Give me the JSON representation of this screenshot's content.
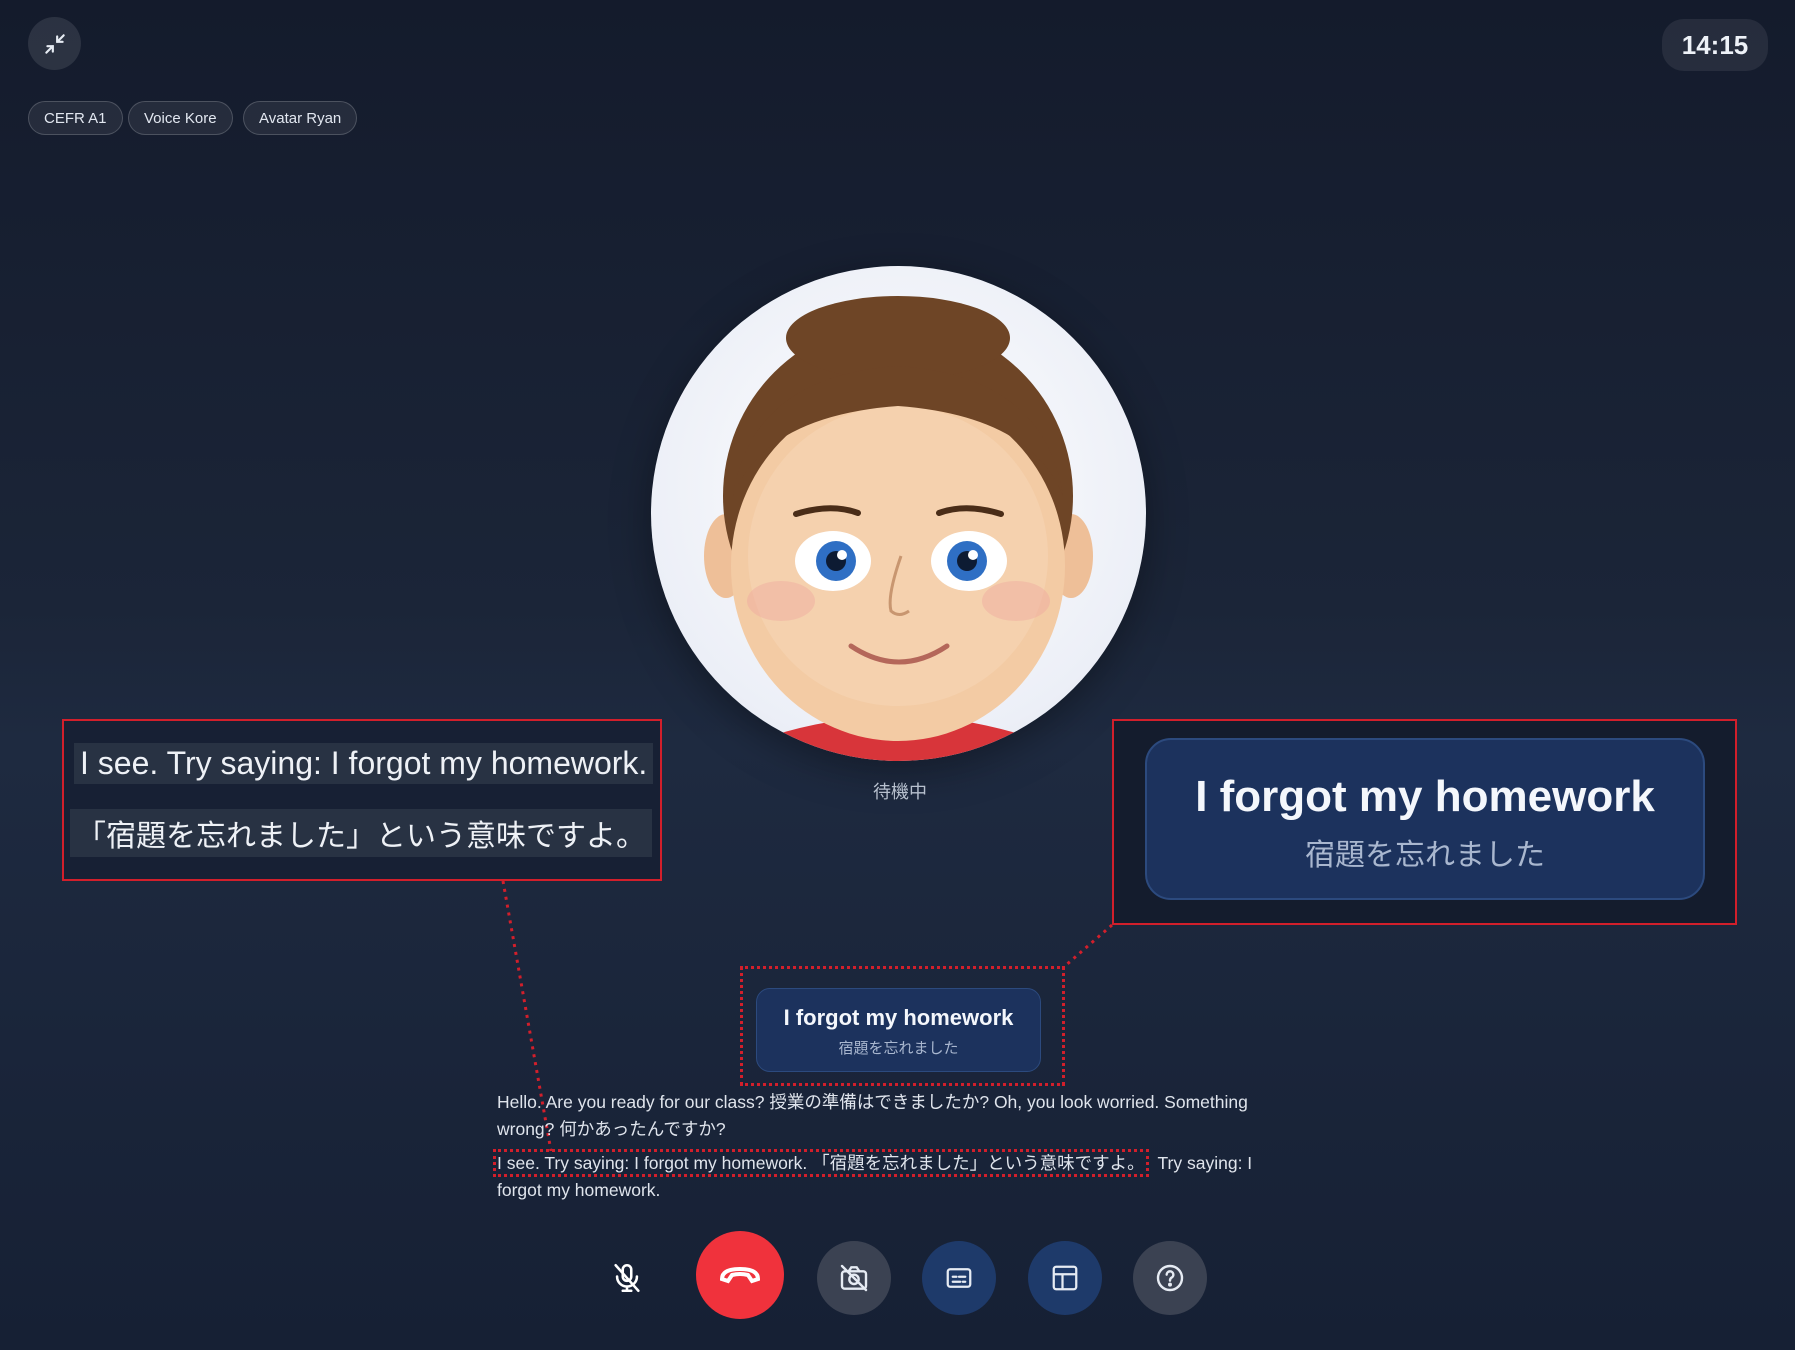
{
  "clock": "14:15",
  "chips": [
    "CEFR A1",
    "Voice Kore",
    "Avatar Ryan"
  ],
  "avatar": {
    "status": "待機中"
  },
  "zoom_left": {
    "line1": "I see. Try saying: I forgot my homework.",
    "line2": "「宿題を忘れました」という意味ですよ。"
  },
  "zoom_right": {
    "title": "I forgot my homework",
    "subtitle": "宿題を忘れました"
  },
  "suggestion": {
    "title": "I forgot my homework",
    "subtitle": "宿題を忘れました"
  },
  "transcript": {
    "line1": "Hello. Are you ready for our class? 授業の準備はできましたか? Oh, you look worried. Something wrong? 何かあったんですか?",
    "line2_highlight": "I see. Try saying: I forgot my homework. 「宿題を忘れました」という意味ですよ。",
    "line2_rest": "Try saying: I forgot my homework."
  },
  "colors": {
    "end_call": "#f0323c",
    "accent_blue": "#1e3a6a",
    "annotation_red": "#d21f2b"
  },
  "icons": [
    "exit-fullscreen-icon",
    "mic-off-icon",
    "phone-hangup-icon",
    "camera-off-icon",
    "captions-icon",
    "layout-icon",
    "help-icon"
  ]
}
